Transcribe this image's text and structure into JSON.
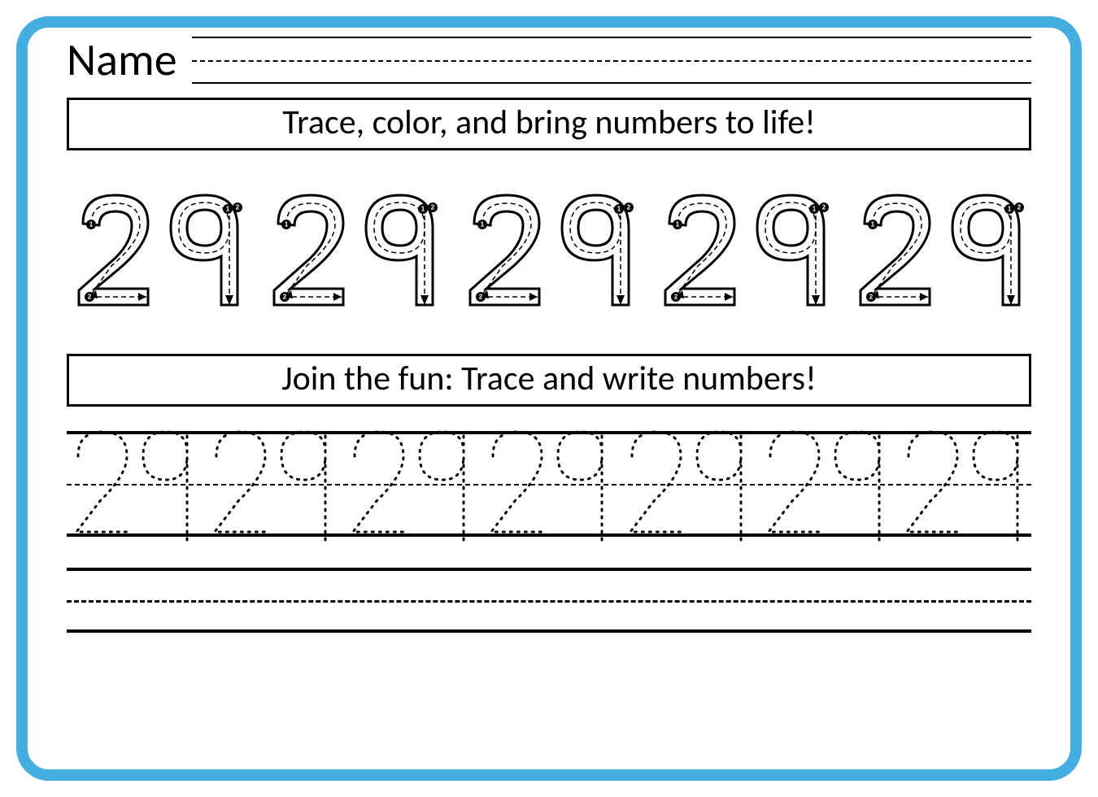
{
  "header": {
    "name_label": "Name"
  },
  "instructions": {
    "line1": "Trace, color, and bring numbers to life!",
    "line2": "Join the fun: Trace and write numbers!"
  },
  "number": {
    "value": "29",
    "big_trace_count": 5,
    "dotted_trace_count": 7,
    "stroke_guides": {
      "digit2": [
        "1",
        "2"
      ],
      "digit9": [
        "1",
        "2"
      ]
    }
  },
  "colors": {
    "border": "#45aee0",
    "ink": "#000000"
  }
}
